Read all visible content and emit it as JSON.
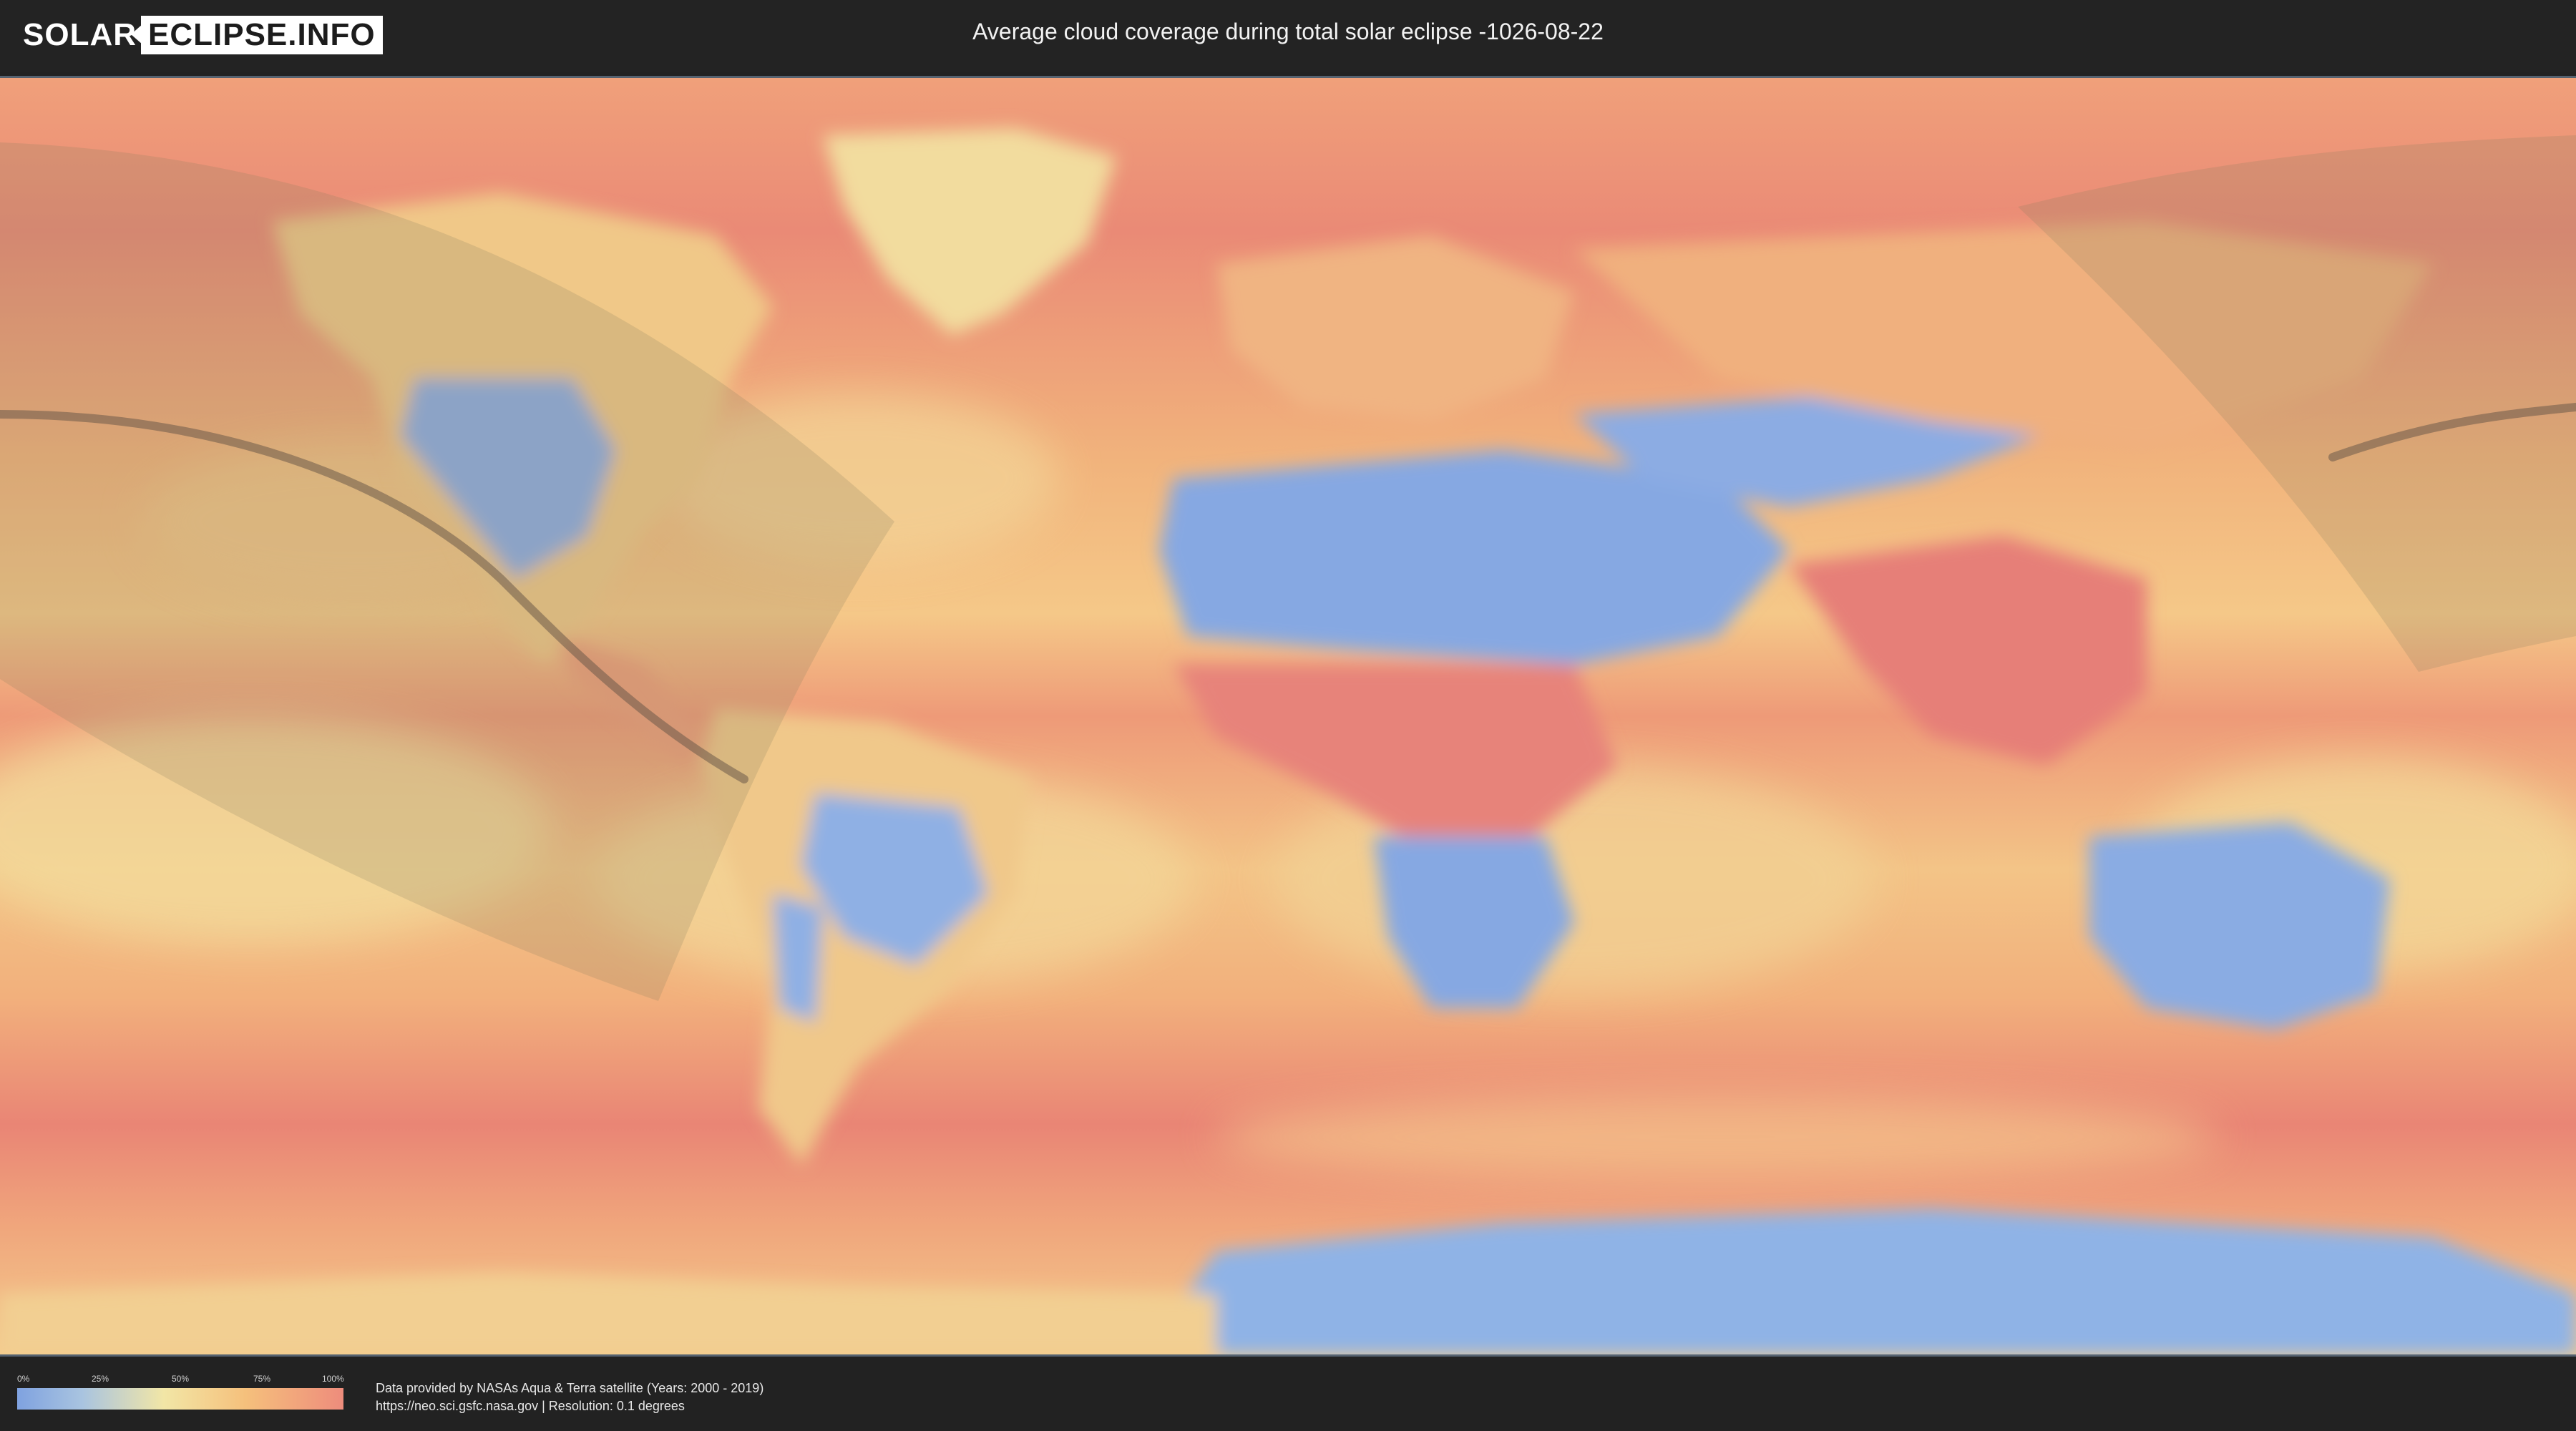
{
  "header": {
    "logo_left": "SOLAR",
    "logo_right": "ECLIPSE.INFO",
    "title": "Average cloud coverage during total solar eclipse -1026-08-22"
  },
  "legend": {
    "ticks": [
      "0%",
      "25%",
      "50%",
      "75%",
      "100%"
    ],
    "colors": [
      "#7fa2e0",
      "#a9c4e0",
      "#f2e6a6",
      "#f5c07c",
      "#ee8c7c"
    ]
  },
  "footer": {
    "credit_line": "Data provided by NASAs Aqua & Terra satellite (Years: 2000 - 2019)",
    "source_line": "https://neo.sci.gsfc.nasa.gov | Resolution: 0.1 degrees"
  },
  "map": {
    "projection": "equirectangular",
    "colors": {
      "ocean_cloudy": "#eea37a",
      "clear": "#86a8e2",
      "mid": "#f2d895",
      "cloudy": "#e98878",
      "eclipse_band": "#8a8060",
      "central_line": "#6b5a48"
    }
  }
}
